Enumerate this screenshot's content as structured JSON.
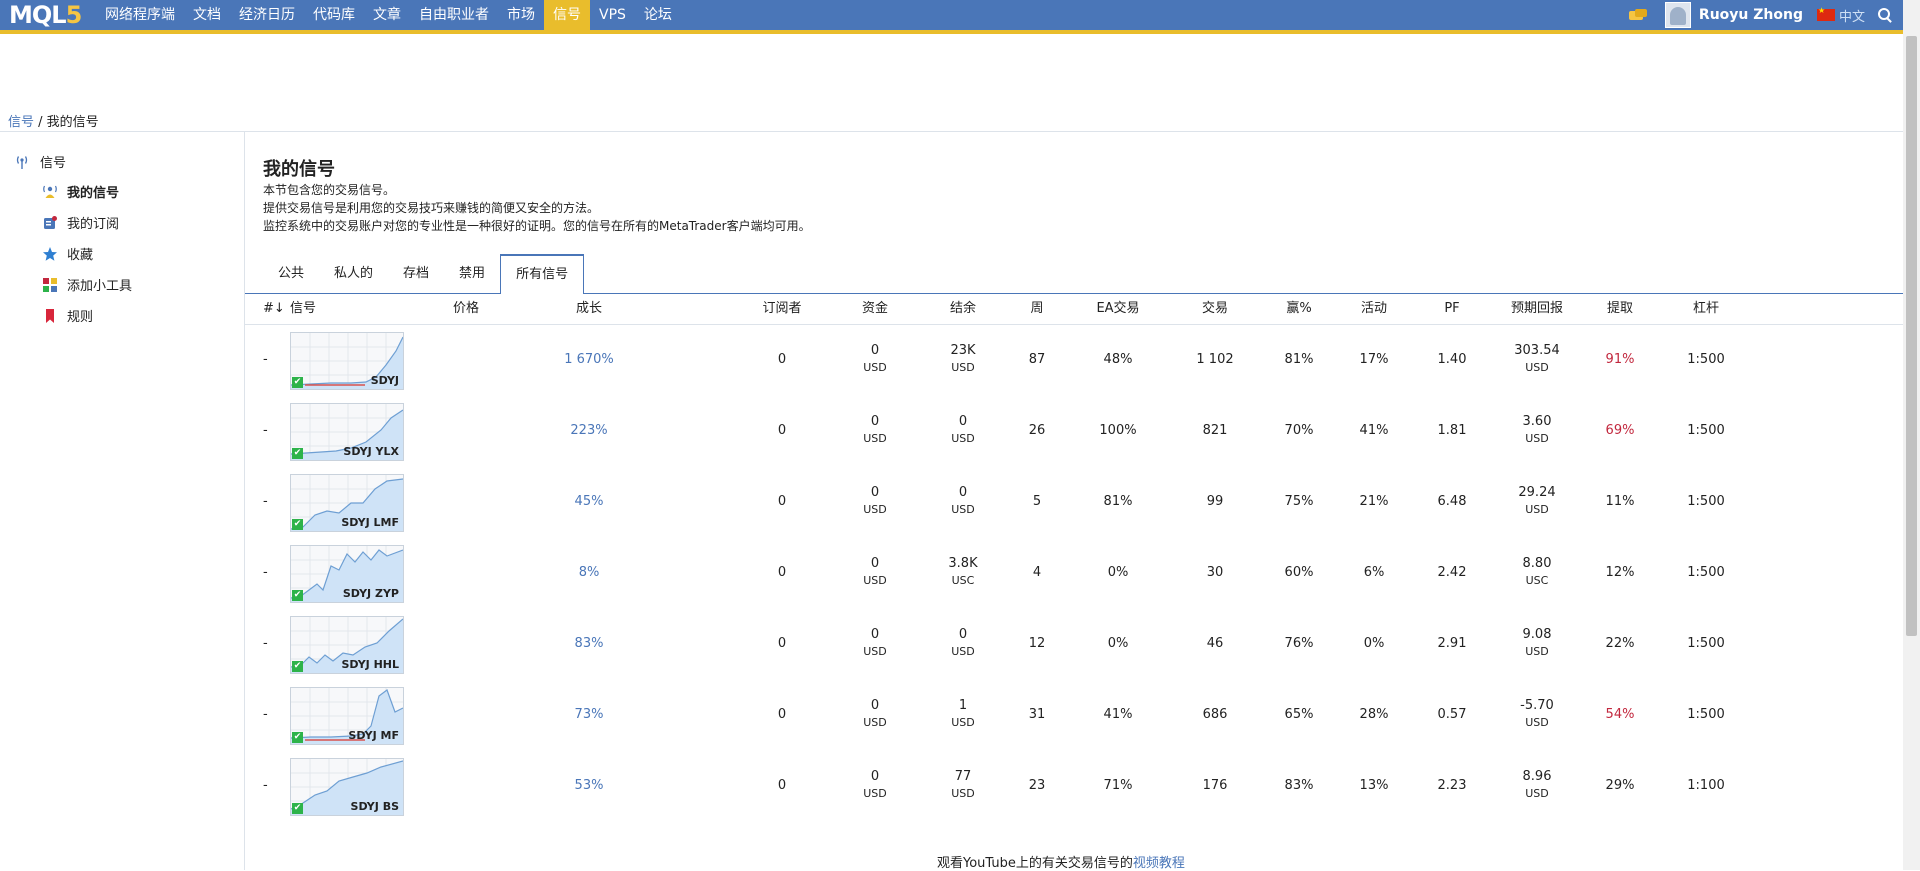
{
  "brand": {
    "logo_main": "MQL",
    "logo_num": "5"
  },
  "nav": [
    "网络程序端",
    "文档",
    "经济日历",
    "代码库",
    "文章",
    "自由职业者",
    "市场",
    "信号",
    "VPS",
    "论坛"
  ],
  "nav_active": "信号",
  "user": {
    "name": "Ruoyu Zhong",
    "lang": "中文"
  },
  "breadcrumb": {
    "root": "信号",
    "sep": " / ",
    "current": "我的信号"
  },
  "sidebar": {
    "root": "信号",
    "items": [
      {
        "label": "我的信号",
        "icon": "signal-user-icon"
      },
      {
        "label": "我的订阅",
        "icon": "subscription-icon"
      },
      {
        "label": "收藏",
        "icon": "star-icon"
      },
      {
        "label": "添加小工具",
        "icon": "widgets-icon"
      },
      {
        "label": "规则",
        "icon": "bookmark-icon"
      }
    ]
  },
  "page": {
    "title": "我的信号",
    "desc": [
      "本节包含您的交易信号。",
      "提供交易信号是利用您的交易技巧来赚钱的简便又安全的方法。",
      "监控系统中的交易账户对您的专业性是一种很好的证明。您的信号在所有的MetaTrader客户端均可用。"
    ]
  },
  "tabs": [
    "公共",
    "私人的",
    "存档",
    "禁用",
    "所有信号"
  ],
  "tab_active": "所有信号",
  "table": {
    "headers": [
      "#↓",
      "信号",
      "价格",
      "成长",
      "订阅者",
      "资金",
      "结余",
      "周",
      "EA交易",
      "交易",
      "赢%",
      "活动",
      "PF",
      "预期回报",
      "提取",
      "杠杆"
    ],
    "rows": [
      {
        "num": "-",
        "name": "SDYJ",
        "price": "",
        "growth": "1 670%",
        "subs": "0",
        "funds": "0",
        "funds_cur": "USD",
        "balance": "23K",
        "balance_cur": "USD",
        "weeks": "87",
        "ea": "48%",
        "trades": "1 102",
        "win": "81%",
        "activity": "17%",
        "pf": "1.40",
        "exp": "303.54",
        "exp_cur": "USD",
        "dd": "91%",
        "dd_red": true,
        "lev": "1:500"
      },
      {
        "num": "-",
        "name": "SDYJ YLX",
        "price": "",
        "growth": "223%",
        "subs": "0",
        "funds": "0",
        "funds_cur": "USD",
        "balance": "0",
        "balance_cur": "USD",
        "weeks": "26",
        "ea": "100%",
        "trades": "821",
        "win": "70%",
        "activity": "41%",
        "pf": "1.81",
        "exp": "3.60",
        "exp_cur": "USD",
        "dd": "69%",
        "dd_red": true,
        "lev": "1:500"
      },
      {
        "num": "-",
        "name": "SDYJ LMF",
        "price": "",
        "growth": "45%",
        "subs": "0",
        "funds": "0",
        "funds_cur": "USD",
        "balance": "0",
        "balance_cur": "USD",
        "weeks": "5",
        "ea": "81%",
        "trades": "99",
        "win": "75%",
        "activity": "21%",
        "pf": "6.48",
        "exp": "29.24",
        "exp_cur": "USD",
        "dd": "11%",
        "dd_red": false,
        "lev": "1:500"
      },
      {
        "num": "-",
        "name": "SDYJ ZYP",
        "price": "",
        "growth": "8%",
        "subs": "0",
        "funds": "0",
        "funds_cur": "USD",
        "balance": "3.8K",
        "balance_cur": "USC",
        "weeks": "4",
        "ea": "0%",
        "trades": "30",
        "win": "60%",
        "activity": "6%",
        "pf": "2.42",
        "exp": "8.80",
        "exp_cur": "USC",
        "dd": "12%",
        "dd_red": false,
        "lev": "1:500"
      },
      {
        "num": "-",
        "name": "SDYJ HHL",
        "price": "",
        "growth": "83%",
        "subs": "0",
        "funds": "0",
        "funds_cur": "USD",
        "balance": "0",
        "balance_cur": "USD",
        "weeks": "12",
        "ea": "0%",
        "trades": "46",
        "win": "76%",
        "activity": "0%",
        "pf": "2.91",
        "exp": "9.08",
        "exp_cur": "USD",
        "dd": "22%",
        "dd_red": false,
        "lev": "1:500"
      },
      {
        "num": "-",
        "name": "SDYJ MF",
        "price": "",
        "growth": "73%",
        "subs": "0",
        "funds": "0",
        "funds_cur": "USD",
        "balance": "1",
        "balance_cur": "USD",
        "weeks": "31",
        "ea": "41%",
        "trades": "686",
        "win": "65%",
        "activity": "28%",
        "pf": "0.57",
        "exp": "-5.70",
        "exp_cur": "USD",
        "dd": "54%",
        "dd_red": true,
        "lev": "1:500"
      },
      {
        "num": "-",
        "name": "SDYJ BS",
        "price": "",
        "growth": "53%",
        "subs": "0",
        "funds": "0",
        "funds_cur": "USD",
        "balance": "77",
        "balance_cur": "USD",
        "weeks": "23",
        "ea": "71%",
        "trades": "176",
        "win": "83%",
        "activity": "13%",
        "pf": "2.23",
        "exp": "8.96",
        "exp_cur": "USD",
        "dd": "29%",
        "dd_red": false,
        "lev": "1:100"
      }
    ]
  },
  "footer": {
    "text": "观看YouTube上的有关交易信号的",
    "link": "视频教程"
  },
  "colors": {
    "header_bg": "#4a76b8",
    "accent": "#e9bd2c",
    "link": "#4a76b8",
    "red": "#c2283e",
    "check": "#2db34a"
  }
}
